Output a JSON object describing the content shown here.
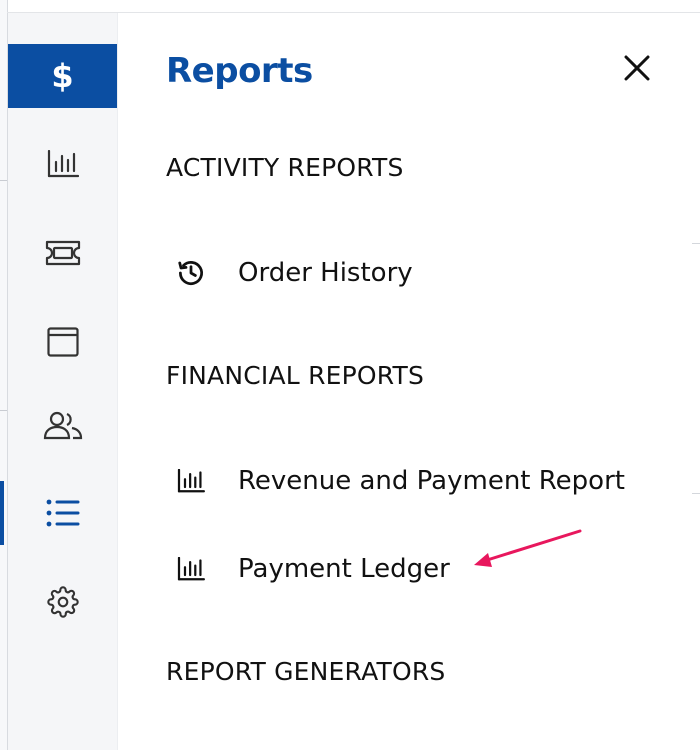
{
  "drawer": {
    "title": "Reports",
    "close_icon": "close-icon",
    "sections": [
      {
        "header": "ACTIVITY REPORTS",
        "items": [
          {
            "label": "Order History",
            "icon": "history-icon"
          }
        ]
      },
      {
        "header": "FINANCIAL REPORTS",
        "items": [
          {
            "label": "Revenue and Payment Report",
            "icon": "bar-chart-icon"
          },
          {
            "label": "Payment Ledger",
            "icon": "bar-chart-icon"
          }
        ]
      },
      {
        "header": "REPORT GENERATORS",
        "items": []
      }
    ]
  },
  "rail": {
    "items": [
      {
        "icon": "dollar-icon",
        "symbol": "$",
        "active": true
      },
      {
        "icon": "bar-chart-icon"
      },
      {
        "icon": "ticket-icon"
      },
      {
        "icon": "window-icon"
      },
      {
        "icon": "users-icon"
      },
      {
        "icon": "list-icon",
        "selected": true
      },
      {
        "icon": "gear-icon"
      }
    ]
  },
  "colors": {
    "accent": "#0b4ea2",
    "rail_background": "#f5f6f8",
    "annotation_arrow": "#e8175d",
    "text": "#111111"
  },
  "annotation": {
    "type": "arrow",
    "points_to": "Payment Ledger"
  }
}
